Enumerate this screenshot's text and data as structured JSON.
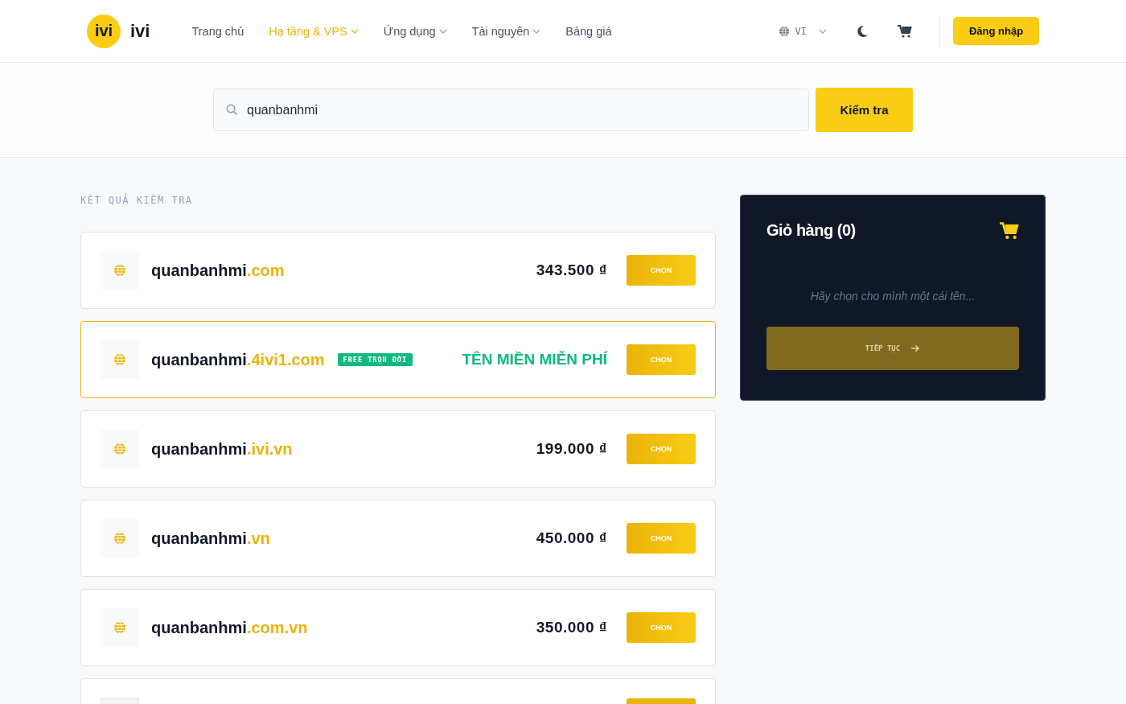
{
  "header": {
    "logo": {
      "mark": "ivi",
      "name": "ivi"
    },
    "nav": [
      {
        "label": "Trang chủ",
        "selected": false,
        "has_menu": false
      },
      {
        "label": "Hạ tầng & VPS",
        "selected": true,
        "has_menu": true
      },
      {
        "label": "Ứng dụng",
        "selected": false,
        "has_menu": true
      },
      {
        "label": "Tài nguyên",
        "selected": false,
        "has_menu": true
      },
      {
        "label": "Bảng giá",
        "selected": false,
        "has_menu": false
      }
    ],
    "language": "VI",
    "login_button": "Đăng nhập"
  },
  "search": {
    "value": "quanbanhmi",
    "button": "Kiểm tra"
  },
  "results": {
    "heading": "KẾT QUẢ KIỂM TRA",
    "items": [
      {
        "kind": "price",
        "name": "quanbanhmi",
        "tld": ".com",
        "price": "343.500 ₫",
        "button": "CHỌN"
      },
      {
        "kind": "free",
        "name": "quanbanhmi",
        "tld": ".4ivi1.com",
        "badge": "FREE TRỌN ĐỜI",
        "price": "TÊN MIỀN MIỄN PHÍ",
        "button": "CHỌN"
      },
      {
        "kind": "price",
        "name": "quanbanhmi",
        "tld": ".ivi.vn",
        "price": "199.000 ₫",
        "button": "CHỌN"
      },
      {
        "kind": "price",
        "name": "quanbanhmi",
        "tld": ".vn",
        "price": "450.000 ₫",
        "button": "CHỌN"
      },
      {
        "kind": "price",
        "name": "quanbanhmi",
        "tld": ".com.vn",
        "price": "350.000 ₫",
        "button": "CHỌN"
      },
      {
        "kind": "cut-off"
      }
    ]
  },
  "cart": {
    "title": "Giỏ hàng (0)",
    "empty_message": "Hãy chọn cho mình một cái tên...",
    "continue_button": "TIẾP TỤC",
    "disabled": true
  }
}
